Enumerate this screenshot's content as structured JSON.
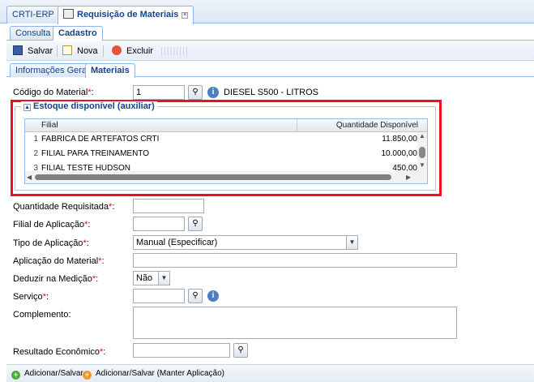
{
  "top_tabs": [
    {
      "label": "CRTI-ERP"
    },
    {
      "label": "Requisição de Materiais",
      "icon": "window-icon"
    }
  ],
  "sub_tabs": [
    {
      "label": "Consulta"
    },
    {
      "label": "Cadastro"
    }
  ],
  "toolbar": {
    "save_label": "Salvar",
    "new_label": "Nova",
    "delete_label": "Excluir"
  },
  "section_tabs": [
    {
      "label": "Informações Gerais"
    },
    {
      "label": "Materiais"
    }
  ],
  "material": {
    "code_label": "Código do Material",
    "code_value": "1",
    "description": "DIESEL S500 - LITROS"
  },
  "stock": {
    "legend": "Estoque disponível (auxiliar)",
    "columns": [
      "Filial",
      "Quantidade Disponível"
    ],
    "rows": [
      {
        "n": "1",
        "filial": "FABRICA DE ARTEFATOS CRTI",
        "qty": "11.850,00"
      },
      {
        "n": "2",
        "filial": "FILIAL PARA TREINAMENTO",
        "qty": "10.000,00"
      },
      {
        "n": "3",
        "filial": "FILIAL TESTE HUDSON",
        "qty": "450,00"
      }
    ]
  },
  "form": {
    "qty_label": "Quantidade Requisitada",
    "filial_label": "Filial de Aplicação",
    "tipo_label": "Tipo de Aplicação",
    "tipo_value": "Manual (Especificar)",
    "aplicacao_label": "Aplicação do Material",
    "deduzir_label": "Deduzir na Medição",
    "deduzir_value": "Não",
    "servico_label": "Serviço",
    "complemento_label": "Complemento",
    "resultado_label": "Resultado Econômico",
    "required_mark": "*",
    "colon": ":"
  },
  "bottom": {
    "add_save_label": "Adicionar/Salvar",
    "add_save_keep_label": "Adicionar/Salvar (Manter Aplicação)"
  },
  "colors": {
    "highlight_border": "#e8111c",
    "required": "#ee0000",
    "accent": "#15428b"
  }
}
